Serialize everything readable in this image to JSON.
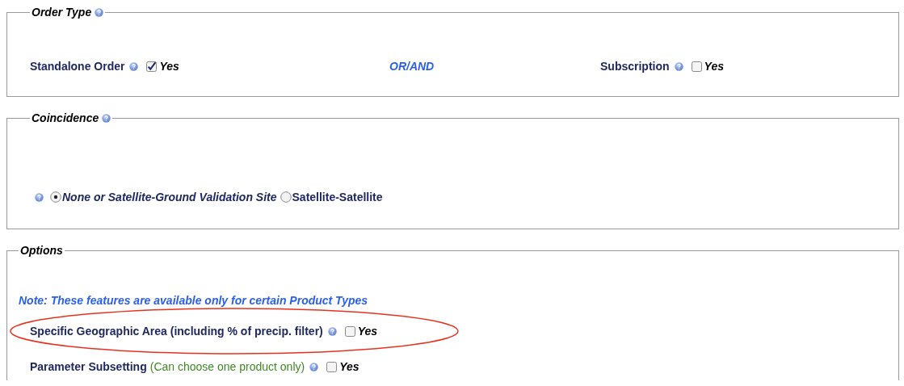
{
  "order_type": {
    "legend": "Order Type",
    "standalone": {
      "label": "Standalone Order",
      "checked": true,
      "option": "Yes"
    },
    "connector": "OR/AND",
    "subscription": {
      "label": "Subscription",
      "checked": false,
      "option": "Yes"
    }
  },
  "coincidence": {
    "legend": "Coincidence",
    "options": [
      {
        "label": "None or Satellite-Ground Validation Site",
        "selected": true
      },
      {
        "label": "Satellite-Satellite",
        "selected": false
      }
    ]
  },
  "options": {
    "legend": "Options",
    "note": "Note: These features are available only for certain Product Types",
    "items": [
      {
        "label": "Specific Geographic Area (including % of precip. filter)",
        "checked": false,
        "option": "Yes",
        "highlighted": true
      },
      {
        "label": "Parameter Subsetting",
        "hint": "(Can choose one product only)",
        "checked": false,
        "option": "Yes",
        "highlighted": false
      }
    ]
  }
}
